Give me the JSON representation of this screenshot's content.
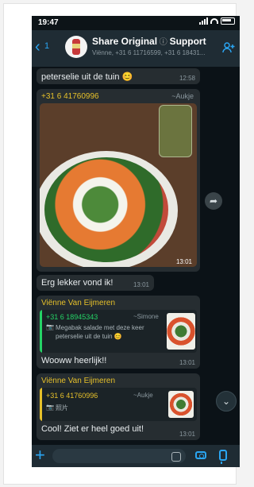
{
  "status_bar": {
    "time": "19:47"
  },
  "header": {
    "back_count": "1",
    "title": "Share Original",
    "title_sep": " ⓘ ",
    "title_support": "Support",
    "subtitle": "Viënne, +31 6 11716599, +31 6 18431..."
  },
  "messages": {
    "m1": {
      "text": "peterselie uit de tuin 😊",
      "time": "12:58"
    },
    "m2": {
      "sender": "+31 6 41760996",
      "sender_alias": "~Aukje",
      "time": "13:01"
    },
    "m3": {
      "text": "Erg lekker vond ik!",
      "time": "13:01"
    },
    "m4": {
      "sender": "Viënne Van Eijmeren",
      "quote_sender": "+31 6 18945343",
      "quote_alias": "~Simone",
      "quote_icon": "📷",
      "quote_text": "Megabak salade met deze keer peterselie uit de tuin 😊",
      "text": "Wooww heerlijk!!",
      "time": "13:01"
    },
    "m5": {
      "sender": "Viënne Van Eijmeren",
      "quote_sender": "+31 6 41760996",
      "quote_alias": "~Aukje",
      "quote_icon": "📷",
      "quote_text": "照片",
      "text": "Cool! Ziet er heel goed uit!",
      "time": "13:01"
    }
  },
  "colors": {
    "accent": "#2aa5f2",
    "sender_yellow": "#e6c02a",
    "quote_green": "#25d366"
  }
}
